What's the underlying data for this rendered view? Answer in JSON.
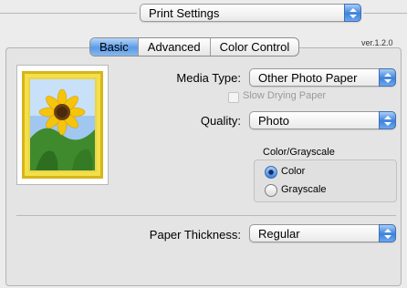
{
  "print_settings": {
    "value": "Print Settings"
  },
  "version": "ver.1.2.0",
  "tabs": [
    {
      "label": "Basic",
      "selected": true
    },
    {
      "label": "Advanced",
      "selected": false
    },
    {
      "label": "Color Control",
      "selected": false
    }
  ],
  "media_type": {
    "label": "Media Type:",
    "value": "Other Photo Paper"
  },
  "slow_drying": {
    "label": "Slow Drying Paper",
    "checked": false,
    "enabled": false
  },
  "quality": {
    "label": "Quality:",
    "value": "Photo"
  },
  "color_mode": {
    "title": "Color/Grayscale",
    "options": [
      {
        "label": "Color",
        "selected": true
      },
      {
        "label": "Grayscale",
        "selected": false
      }
    ]
  },
  "paper_thickness": {
    "label": "Paper Thickness:",
    "value": "Regular"
  },
  "colors": {
    "accent": "#3d82dc",
    "thumbnail_frame": "#e8c81a"
  }
}
